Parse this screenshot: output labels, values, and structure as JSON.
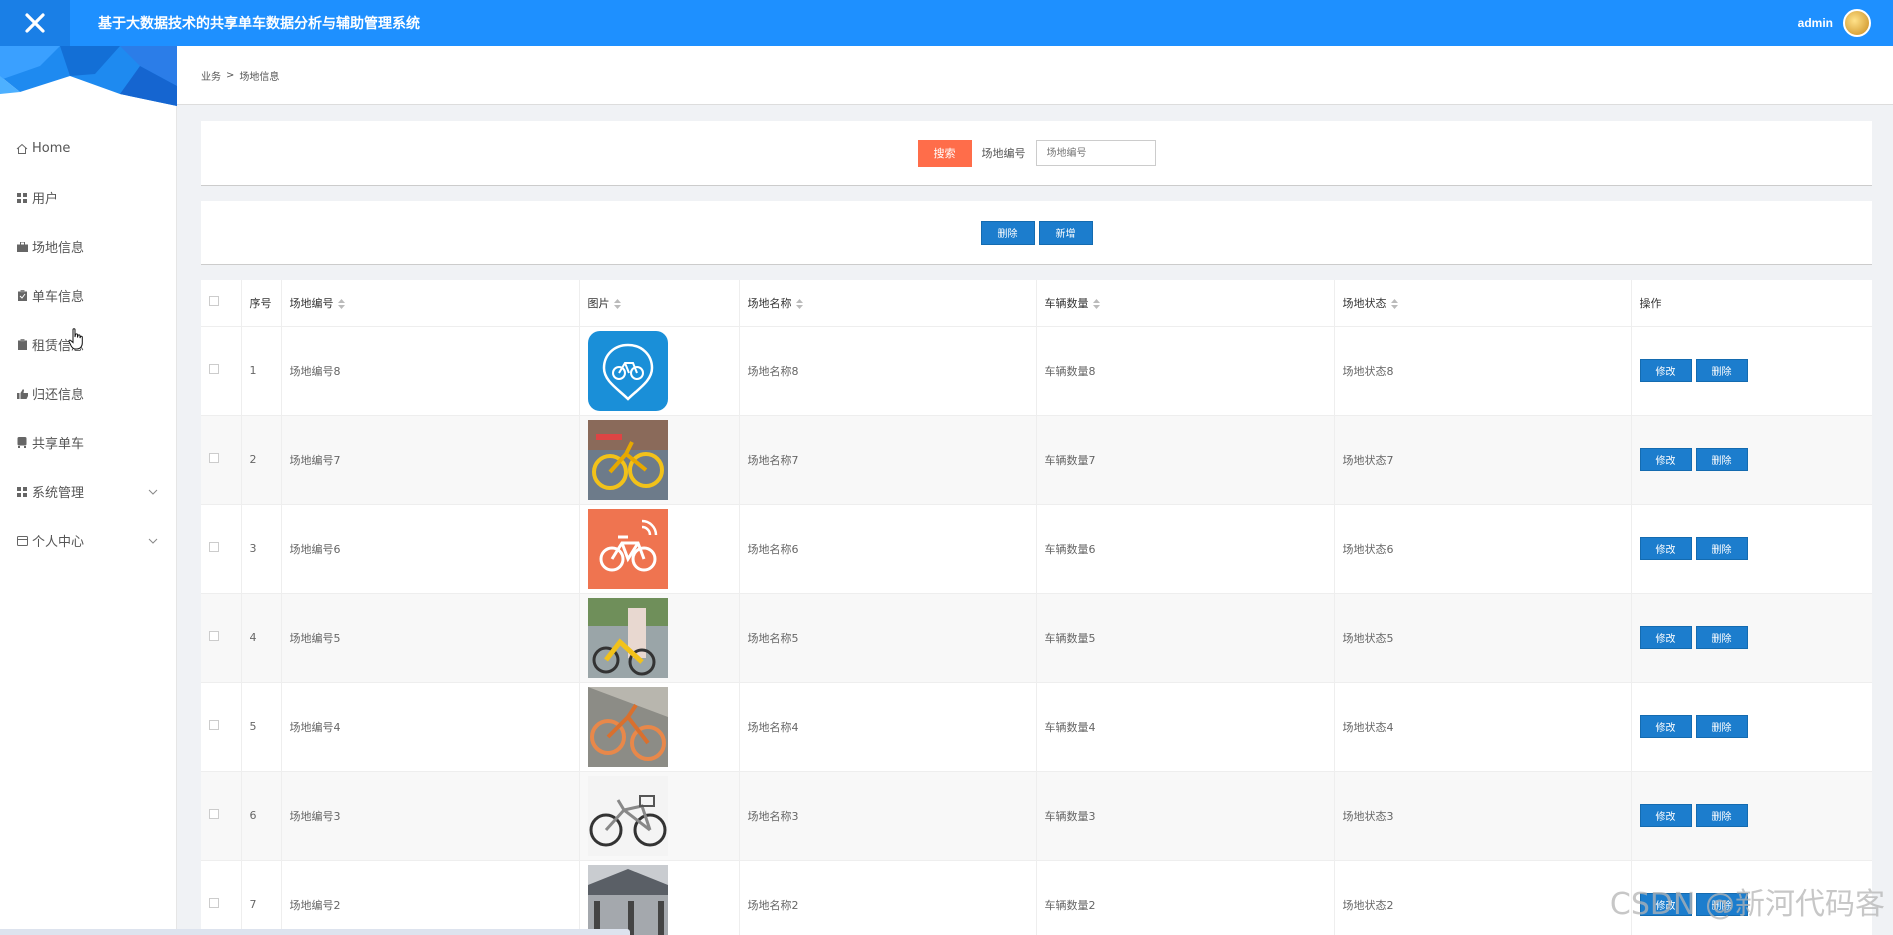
{
  "header": {
    "title": "基于大数据技术的共享单车数据分析与辅助管理系统",
    "user": "admin"
  },
  "sidebar": {
    "items": [
      {
        "label": "Home",
        "icon": "home-icon"
      },
      {
        "label": "用户",
        "icon": "grid-icon"
      },
      {
        "label": "场地信息",
        "icon": "briefcase-icon"
      },
      {
        "label": "单车信息",
        "icon": "clipboard-icon"
      },
      {
        "label": "租赁信息",
        "icon": "clipboard-icon"
      },
      {
        "label": "归还信息",
        "icon": "thumbs-up-icon"
      },
      {
        "label": "共享单车",
        "icon": "bus-icon"
      },
      {
        "label": "系统管理",
        "icon": "grid-icon",
        "expandable": true
      },
      {
        "label": "个人中心",
        "icon": "card-icon",
        "expandable": true
      }
    ]
  },
  "breadcrumb": {
    "root": "业务",
    "sep": ">",
    "current": "场地信息"
  },
  "search": {
    "button": "搜索",
    "label": "场地编号",
    "placeholder": "场地编号"
  },
  "actions": {
    "delete": "删除",
    "add": "新增"
  },
  "table": {
    "headers": {
      "index": "序号",
      "code": "场地编号",
      "image": "图片",
      "name": "场地名称",
      "count": "车辆数量",
      "status": "场地状态",
      "ops": "操作"
    },
    "edit_label": "修改",
    "delete_label": "删除",
    "rows": [
      {
        "index": "1",
        "code": "场地编号8",
        "name": "场地名称8",
        "count": "车辆数量8",
        "status": "场地状态8"
      },
      {
        "index": "2",
        "code": "场地编号7",
        "name": "场地名称7",
        "count": "车辆数量7",
        "status": "场地状态7"
      },
      {
        "index": "3",
        "code": "场地编号6",
        "name": "场地名称6",
        "count": "车辆数量6",
        "status": "场地状态6"
      },
      {
        "index": "4",
        "code": "场地编号5",
        "name": "场地名称5",
        "count": "车辆数量5",
        "status": "场地状态5"
      },
      {
        "index": "5",
        "code": "场地编号4",
        "name": "场地名称4",
        "count": "车辆数量4",
        "status": "场地状态4"
      },
      {
        "index": "6",
        "code": "场地编号3",
        "name": "场地名称3",
        "count": "车辆数量3",
        "status": "场地状态3"
      },
      {
        "index": "7",
        "code": "场地编号2",
        "name": "场地名称2",
        "count": "车辆数量2",
        "status": "场地状态2"
      }
    ]
  },
  "watermark": "CSDN @新河代码客",
  "colors": {
    "topbar": "#1e90ff",
    "search_button": "#ff6d4a",
    "action_button": "#1c7dcd"
  }
}
